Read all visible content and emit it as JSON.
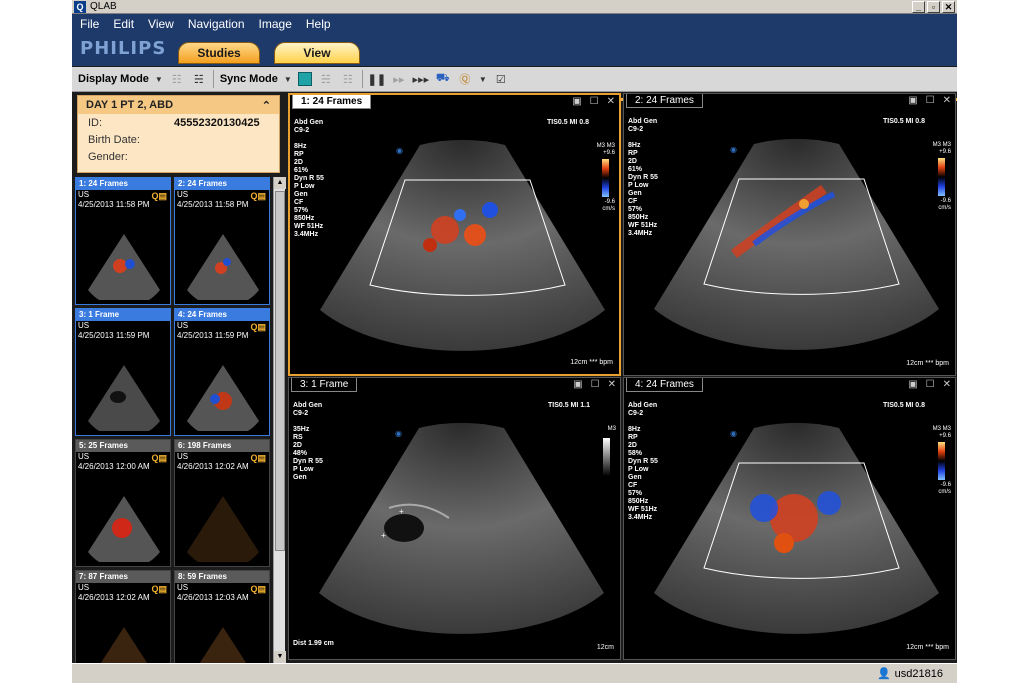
{
  "window": {
    "title": "QLAB",
    "logo_letter": "Q",
    "btn_min": "_",
    "btn_max": "▫",
    "btn_close": "✕"
  },
  "menu": [
    {
      "label": "File"
    },
    {
      "label": "Edit"
    },
    {
      "label": "View"
    },
    {
      "label": "Navigation"
    },
    {
      "label": "Image"
    },
    {
      "label": "Help"
    }
  ],
  "brand": {
    "name": "PHILIPS",
    "tabs": {
      "studies": "Studies",
      "view": "View"
    }
  },
  "toolbar": {
    "display_mode": "Display Mode",
    "sync_mode": "Sync Mode"
  },
  "patient": {
    "header": "DAY 1 PT 2, ABD",
    "id_label": "ID:",
    "id_value": "45552320130425",
    "birth_label": "Birth Date:",
    "birth_value": "",
    "gender_label": "Gender:",
    "gender_value": ""
  },
  "thumbnails": [
    {
      "title": "1: 24 Frames",
      "modality": "US",
      "date": "4/25/2013 11:58 PM",
      "selected": true
    },
    {
      "title": "2: 24 Frames",
      "modality": "US",
      "date": "4/25/2013 11:58 PM",
      "selected": true
    },
    {
      "title": "3: 1 Frame",
      "modality": "US",
      "date": "4/25/2013 11:59 PM",
      "selected": true
    },
    {
      "title": "4: 24 Frames",
      "modality": "US",
      "date": "4/25/2013 11:59 PM",
      "selected": true
    },
    {
      "title": "5: 25 Frames",
      "modality": "US",
      "date": "4/26/2013 12:00 AM",
      "selected": false
    },
    {
      "title": "6: 198 Frames",
      "modality": "US",
      "date": "4/26/2013 12:02 AM",
      "selected": false
    },
    {
      "title": "7: 87 Frames",
      "modality": "US",
      "date": "4/26/2013 12:02 AM",
      "selected": false
    },
    {
      "title": "8: 59 Frames",
      "modality": "US",
      "date": "4/26/2013 12:03 AM",
      "selected": false
    }
  ],
  "viewports": [
    {
      "tab": "1: 24 Frames",
      "active": true,
      "preset": "Abd Gen",
      "probe": "C9-2",
      "params": [
        "8Hz",
        "RP",
        "",
        "2D",
        "61%",
        "Dyn R 55",
        "P Low",
        "Gen",
        "",
        "CF",
        "57%",
        "850Hz",
        "WF 51Hz",
        "3.4MHz"
      ],
      "tis": "TIS0.5  MI 0.8",
      "scale_top": "M3 M3",
      "scale_max": "+9.6",
      "scale_min": "-9.6",
      "scale_unit": "cm/s",
      "bottom": "*** bpm",
      "depth": "12cm",
      "dist": ""
    },
    {
      "tab": "2: 24 Frames",
      "active": false,
      "preset": "Abd Gen",
      "probe": "C9-2",
      "params": [
        "8Hz",
        "RP",
        "",
        "2D",
        "61%",
        "Dyn R 55",
        "P Low",
        "Gen",
        "",
        "CF",
        "57%",
        "850Hz",
        "WF 51Hz",
        "3.4MHz"
      ],
      "tis": "TIS0.5  MI 0.8",
      "scale_top": "M3 M3",
      "scale_max": "+9.6",
      "scale_min": "-9.6",
      "scale_unit": "cm/s",
      "bottom": "*** bpm",
      "depth": "12cm",
      "dist": ""
    },
    {
      "tab": "3: 1 Frame",
      "active": false,
      "preset": "Abd Gen",
      "probe": "C9-2",
      "params": [
        "35Hz",
        "RS",
        "",
        "2D",
        "48%",
        "Dyn R 55",
        "P Low",
        "Gen"
      ],
      "tis": "TIS0.5  MI 1.1",
      "scale_top": "M3",
      "scale_max": "",
      "scale_min": "",
      "scale_unit": "",
      "bottom": "",
      "depth": "12cm",
      "dist": "Dist   1.99 cm"
    },
    {
      "tab": "4: 24 Frames",
      "active": false,
      "preset": "Abd Gen",
      "probe": "C9-2",
      "params": [
        "8Hz",
        "RP",
        "",
        "2D",
        "58%",
        "Dyn R 55",
        "P Low",
        "Gen",
        "",
        "CF",
        "57%",
        "850Hz",
        "WF 51Hz",
        "3.4MHz"
      ],
      "tis": "TIS0.5  MI 0.8",
      "scale_top": "M3 M3",
      "scale_max": "+9.6",
      "scale_min": "-9.6",
      "scale_unit": "cm/s",
      "bottom": "*** bpm",
      "depth": "12cm",
      "dist": ""
    }
  ],
  "status": {
    "user": "usd21816"
  },
  "colors": {
    "menu_bg": "#1e3a6a",
    "accent": "#f3b340",
    "selection": "#3a7be0"
  }
}
